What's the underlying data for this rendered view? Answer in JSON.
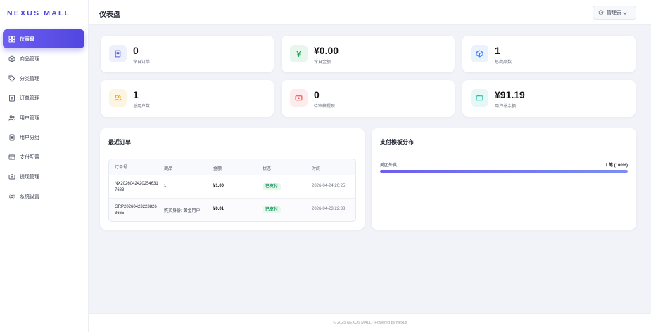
{
  "brand": "NEXUS MALL",
  "sidebar": {
    "items": [
      {
        "label": "仪表盘",
        "icon": "dashboard-icon"
      },
      {
        "label": "商品管理",
        "icon": "box-icon"
      },
      {
        "label": "分类管理",
        "icon": "tag-icon"
      },
      {
        "label": "订单管理",
        "icon": "receipt-icon"
      },
      {
        "label": "用户管理",
        "icon": "users-icon"
      },
      {
        "label": "用户分组",
        "icon": "badge-icon"
      },
      {
        "label": "支付配置",
        "icon": "card-icon"
      },
      {
        "label": "提现管理",
        "icon": "wallet-icon"
      },
      {
        "label": "系统设置",
        "icon": "gear-icon"
      }
    ]
  },
  "header": {
    "title": "仪表盘",
    "user_label": "管理员"
  },
  "stats": [
    {
      "value": "0",
      "label": "今日订单",
      "icon": "document-icon",
      "color": "#5b5bd6",
      "bg": "#eef0fc"
    },
    {
      "value": "¥0.00",
      "label": "今日金额",
      "icon": "yen-icon",
      "color": "#16a34a",
      "bg": "#e8f7ee"
    },
    {
      "value": "1",
      "label": "总商品数",
      "icon": "box-icon",
      "color": "#3b82f6",
      "bg": "#eaf2fd"
    },
    {
      "value": "1",
      "label": "总用户数",
      "icon": "users-icon",
      "color": "#e0a100",
      "bg": "#fdf5e3"
    },
    {
      "value": "0",
      "label": "待审核提现",
      "icon": "cash-icon",
      "color": "#e53e3e",
      "bg": "#fdecec"
    },
    {
      "value": "¥91.19",
      "label": "用户总余额",
      "icon": "wallet-icon",
      "color": "#14b8a6",
      "bg": "#e6f8f5"
    }
  ],
  "recent_orders": {
    "title": "最近订单",
    "columns": [
      "订单号",
      "商品",
      "金额",
      "状态",
      "时间"
    ],
    "rows": [
      {
        "order_no": "NX20260424202546317683",
        "product": "1",
        "amount": "¥1.00",
        "status": "已支付",
        "time": "2026-04-24 20:25"
      },
      {
        "order_no": "GRP20260423223826366​5",
        "product": "购买身份: 黄金用户",
        "amount": "¥0.01",
        "status": "已支付",
        "time": "2026-04-23 22:38"
      }
    ]
  },
  "payment_distribution": {
    "title": "支付模板分布",
    "items": [
      {
        "name": "美团外卖",
        "value_text": "1 笔 (100%)",
        "fraction": 1.0
      }
    ]
  },
  "footer": "© 2025 NEXUS MALL · Powered by Nexus"
}
